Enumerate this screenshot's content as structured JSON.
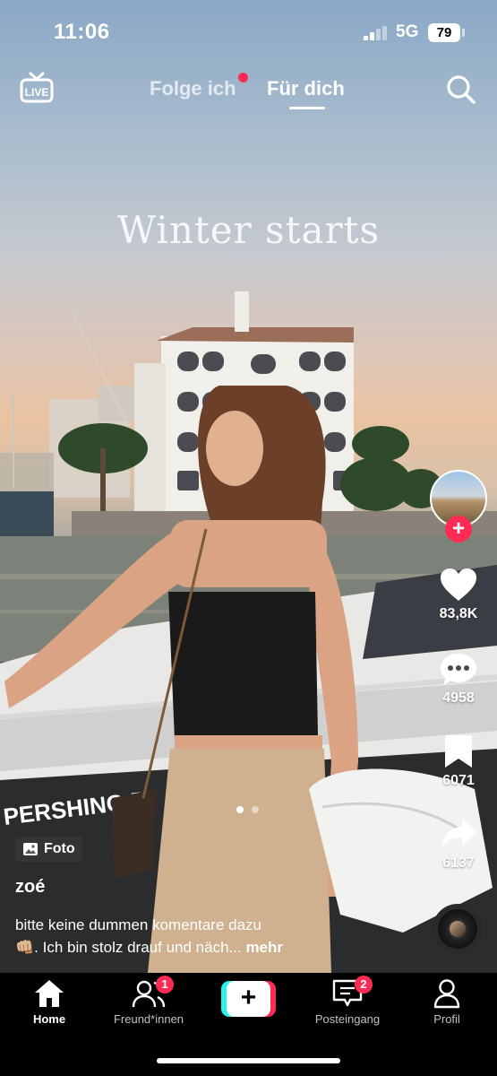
{
  "status_bar": {
    "time": "11:06",
    "network": "5G",
    "battery": "79"
  },
  "top_nav": {
    "live_label": "LIVE",
    "tab_following": "Folge ich",
    "tab_for_you": "Für dich"
  },
  "post": {
    "overlay_text": "Winter starts",
    "media_type_label": "Foto",
    "username": "zoé",
    "caption_line1": "bitte keine dummen komentare dazu",
    "caption_emoji": "👊🏼",
    "caption_line2": ". Ich bin stolz drauf und näch...",
    "more_label": "mehr",
    "boat_text": "PERSHING 5"
  },
  "actions": {
    "likes": "83,8K",
    "comments": "4958",
    "saves": "6071",
    "shares": "6137"
  },
  "tab_bar": {
    "home": "Home",
    "friends": "Freund*innen",
    "friends_badge": "1",
    "inbox": "Posteingang",
    "inbox_badge": "2",
    "profile": "Profil",
    "create": "+"
  },
  "colors": {
    "accent": "#fe2c55",
    "cyan": "#25f4ee"
  }
}
